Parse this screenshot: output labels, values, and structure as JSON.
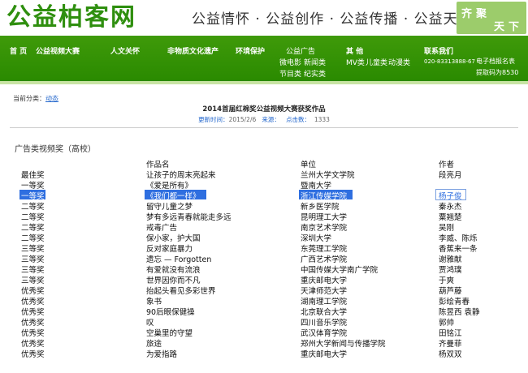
{
  "header": {
    "logo": "公益柏客网",
    "slogan": "公益情怀 · 公益创作 · 公益传播 · 公益天下",
    "badge": [
      "齐",
      "聚",
      "天",
      "下"
    ]
  },
  "nav": {
    "home": "首 页",
    "video": "公益视频大赛",
    "humanity": "人文关怀",
    "heritage": "非物质文化遗产",
    "env": "环境保护",
    "ads": "公益广告",
    "micro": "微电影",
    "news": "新闻类",
    "program": "节目类",
    "doc": "纪实类",
    "others": "其 他",
    "mv": "MV类",
    "kids": "儿童类",
    "anim": "动漫类",
    "contact": "联系我们",
    "phone": "020-83313888-67",
    "email_label": "电子档报名表",
    "code": "提取码为8530"
  },
  "breadcrumb": {
    "label": "当前分类：",
    "link": "动态"
  },
  "article": {
    "title": "2014首届红棉奖公益视频大赛获奖作品",
    "time_label": "更新时间：",
    "time": "2015/2/6",
    "source_label": "来源：",
    "clicks_label": "点击数：",
    "clicks": "1333"
  },
  "section_title": "广告类视频奖（高校）",
  "table": {
    "headers": [
      "",
      "作品名",
      "单位",
      "作者"
    ],
    "rows": [
      [
        "最佳奖",
        "让孩子的周末亮起来",
        "兰州大学文学院",
        "段亮月"
      ],
      [
        "一等奖",
        "《爱是所有》",
        "暨南大学",
        ""
      ],
      [
        "一等奖",
        "《我们都一样》",
        "浙江传媒学院",
        "杨子俊"
      ],
      [
        "二等奖",
        "留守儿童之梦",
        "新乡医学院",
        "秦永杰"
      ],
      [
        "二等奖",
        "梦有多远青春就能走多远",
        "昆明理工大学",
        "粟翘楚"
      ],
      [
        "二等奖",
        "戒毒广告",
        "南京艺术学院",
        "吴刚"
      ],
      [
        "二等奖",
        "保小家，护大国",
        "深圳大学",
        "李威、陈烁"
      ],
      [
        "三等奖",
        "反对家庭暴力",
        "东莞理工学院",
        "香蕉来一条"
      ],
      [
        "三等奖",
        "遗忘 — Forgotten",
        "广西艺术学院",
        "谢雅献"
      ],
      [
        "三等奖",
        "有爱就没有流浪",
        "中国传媒大学南广学院",
        "贾鸿璞"
      ],
      [
        "三等奖",
        "世界因你而不凡",
        "重庆邮电大学",
        "于爽"
      ],
      [
        "优秀奖",
        "抬起头看见多彩世界",
        "天津师范大学",
        "葫芦藤"
      ],
      [
        "优秀奖",
        "象书",
        "湖南理工学院",
        "彭绘青春"
      ],
      [
        "优秀奖",
        "90后眼保健操",
        "北京联合大学",
        "陈昱西 袁静"
      ],
      [
        "优秀奖",
        "叹",
        "四川音乐学院",
        "郭帅"
      ],
      [
        "优秀奖",
        "空巢里的守望",
        "武汉体育学院",
        "田铭江"
      ],
      [
        "优秀奖",
        "旅途",
        "郑州大学新闻与传播学院",
        "齐曼菲"
      ],
      [
        "优秀奖",
        "为爱指路",
        "重庆邮电大学",
        "杨双双"
      ]
    ]
  },
  "colors": {
    "nav_green": "#2a8a00",
    "selection": "#2f6fe0",
    "link": "#2266cc"
  }
}
